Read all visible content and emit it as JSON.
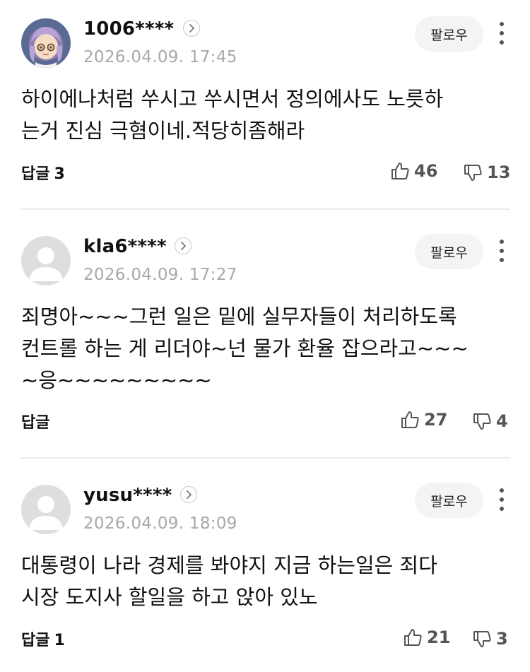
{
  "comments": [
    {
      "username": "1006****",
      "timestamp": "2026.04.09. 17:45",
      "follow_label": "팔로우",
      "avatar_type": "character-illustration",
      "body": "하이에나처럼 쑤시고 쑤시면서 정의에사도 노릇하\n는거 진심 극혐이네.적당히좀해라",
      "reply_label": "답글",
      "reply_count": "3",
      "likes": "46",
      "dislikes": "13"
    },
    {
      "username": "kla6****",
      "timestamp": "2026.04.09. 17:27",
      "follow_label": "팔로우",
      "avatar_type": "default-person",
      "body": "죄명아~~~그런 일은 밑에 실무자들이 처리하도록\n컨트롤 하는 게 리더야~넌 물가 환율 잡으라고~~~\n~응~~~~~~~~~",
      "reply_label": "답글",
      "reply_count": "",
      "likes": "27",
      "dislikes": "4"
    },
    {
      "username": "yusu****",
      "timestamp": "2026.04.09. 18:09",
      "follow_label": "팔로우",
      "avatar_type": "default-person",
      "body": "대통령이 나라 경제를 봐야지 지금 하는일은 죄다\n시장 도지사 할일을 하고 앉아 있노",
      "reply_label": "답글",
      "reply_count": "1",
      "likes": "21",
      "dislikes": "3"
    }
  ],
  "icons": {
    "profile_arrow": "chevron-right-icon",
    "more": "more-vertical-icon",
    "like": "thumbs-up-icon",
    "dislike": "thumbs-down-icon"
  },
  "colors": {
    "text": "#111111",
    "muted": "#a8a8a8",
    "follow_bg": "#f4f4f4",
    "divider": "#ececec",
    "count_gray": "#555555"
  }
}
